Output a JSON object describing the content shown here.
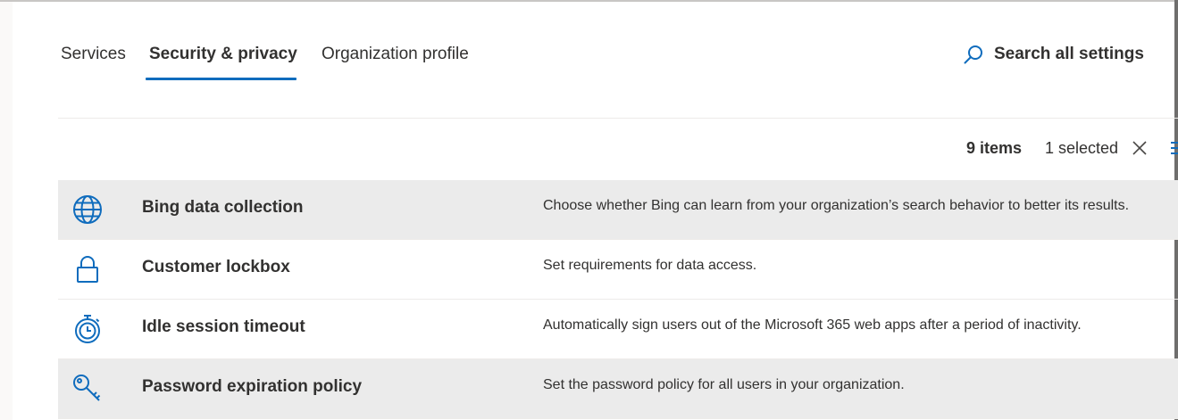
{
  "tabs": [
    {
      "label": "Services"
    },
    {
      "label": "Security & privacy",
      "active": true
    },
    {
      "label": "Organization profile"
    }
  ],
  "search": {
    "label": "Search all settings",
    "icon": "search-icon"
  },
  "toolbar": {
    "count": "9 items",
    "selected": "1 selected",
    "clear_icon": "close-icon",
    "menu_icon": "list-icon"
  },
  "colors": {
    "accent": "#0f6cbd",
    "icon": "#0f6cbd",
    "selected_row": "#ebebeb"
  },
  "items": [
    {
      "name": "Bing data collection",
      "description": "Choose whether Bing can learn from your organization’s search behavior to better its results.",
      "icon": "globe-icon",
      "selected": true
    },
    {
      "name": "Customer lockbox",
      "description": "Set requirements for data access.",
      "icon": "lock-icon"
    },
    {
      "name": "Idle session timeout",
      "description": "Automatically sign users out of the Microsoft 365 web apps after a period of inactivity.",
      "icon": "timer-icon"
    },
    {
      "name": "Password expiration policy",
      "description": "Set the password policy for all users in your organization.",
      "icon": "key-icon"
    }
  ]
}
